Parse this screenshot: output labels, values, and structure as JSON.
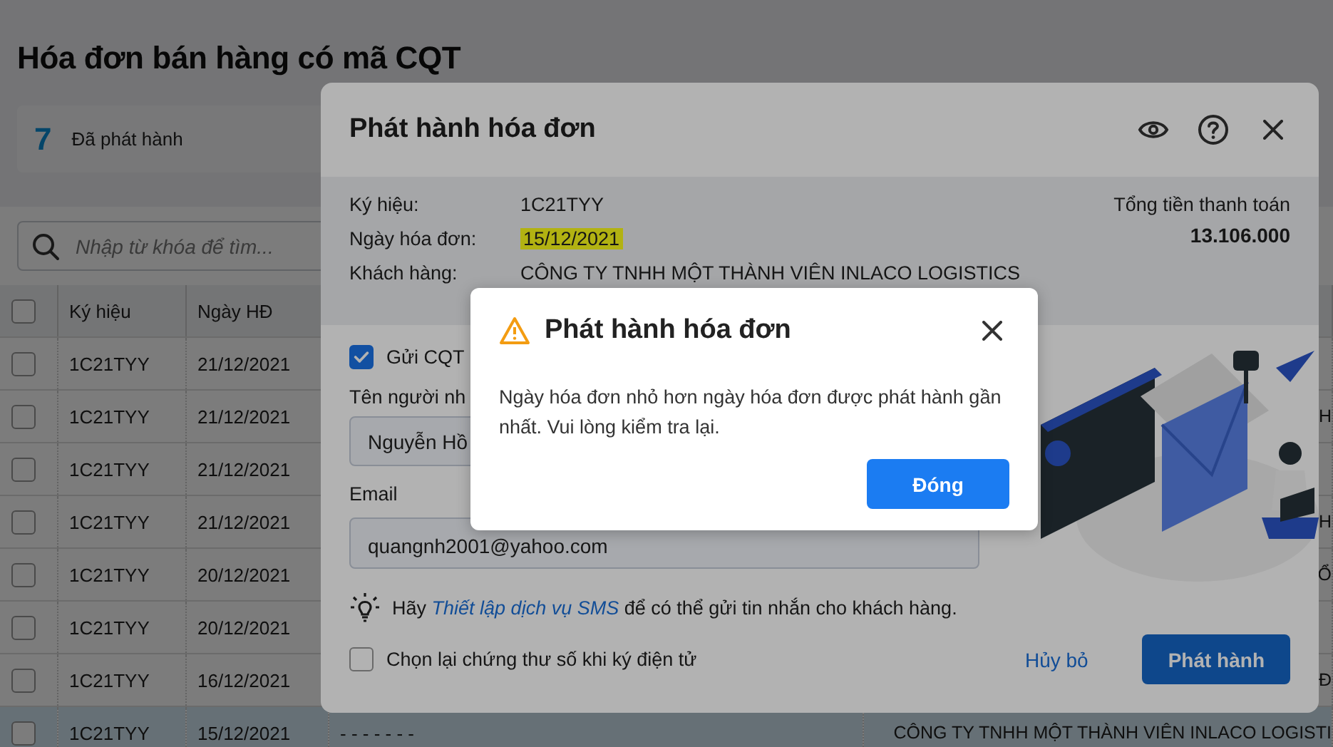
{
  "page": {
    "title": "Hóa đơn bán hàng có mã CQT",
    "stats": {
      "count": "7",
      "label": "Đã phát hành"
    },
    "search": {
      "placeholder": "Nhập từ khóa để tìm..."
    }
  },
  "table": {
    "select_all": {
      "checked": false
    },
    "columns": [
      "Ký hiệu",
      "Ngày HĐ"
    ],
    "rows": [
      {
        "checked": false,
        "selected": false,
        "symbol": "1C21TYY",
        "date": "21/12/2021"
      },
      {
        "checked": false,
        "selected": false,
        "symbol": "1C21TYY",
        "date": "21/12/2021",
        "customer": "H"
      },
      {
        "checked": false,
        "selected": false,
        "symbol": "1C21TYY",
        "date": "21/12/2021"
      },
      {
        "checked": false,
        "selected": false,
        "symbol": "1C21TYY",
        "date": "21/12/2021",
        "customer": "H"
      },
      {
        "checked": false,
        "selected": false,
        "symbol": "1C21TYY",
        "date": "20/12/2021",
        "customer": "Ổ"
      },
      {
        "checked": false,
        "selected": false,
        "symbol": "1C21TYY",
        "date": "20/12/2021"
      },
      {
        "checked": false,
        "selected": false,
        "symbol": "1C21TYY",
        "date": "16/12/2021",
        "customer": "Đ"
      },
      {
        "checked": false,
        "selected": true,
        "symbol": "1C21TYY",
        "date": "15/12/2021",
        "column_4": "- - - - - - -",
        "customer": "CÔNG TY TNHH MỘT THÀNH VIÊN INLACO LOGISTI"
      }
    ]
  },
  "issue_dialog": {
    "title": "Phát hành hóa đơn",
    "info": [
      {
        "label": "Ký hiệu:",
        "value": "1C21TYY",
        "highlighted": false
      },
      {
        "label": "Ngày hóa đơn:",
        "value": "15/12/2021",
        "highlighted": true
      },
      {
        "label": "Khách hàng:",
        "value": "CÔNG TY TNHH MỘT THÀNH VIÊN INLACO LOGISTICS",
        "highlighted": false
      }
    ],
    "total": {
      "label": "Tổng tiền thanh toán",
      "value": "13.106.000"
    },
    "send_cqt": {
      "label": "Gửi CQT",
      "checked": true
    },
    "recipient": {
      "label": "Tên người nh",
      "value": "Nguyễn Hồ"
    },
    "email": {
      "label": "Email",
      "value": "quangnh2001@yahoo.com"
    },
    "hint": {
      "before": "Hãy",
      "link": "Thiết lập dịch vụ SMS",
      "after": "để có thể gửi tin nhắn cho khách hàng."
    },
    "reselect_cert": {
      "label": "Chọn lại chứng thư số khi ký điện tử",
      "checked": false
    },
    "cancel": "Hủy bỏ",
    "submit": "Phát hành"
  },
  "alert": {
    "title": "Phát hành hóa đơn",
    "message": "Ngày hóa đơn nhỏ hơn ngày hóa đơn được phát hành gần nhất. Vui lòng kiểm tra lại.",
    "button": "Đóng"
  }
}
